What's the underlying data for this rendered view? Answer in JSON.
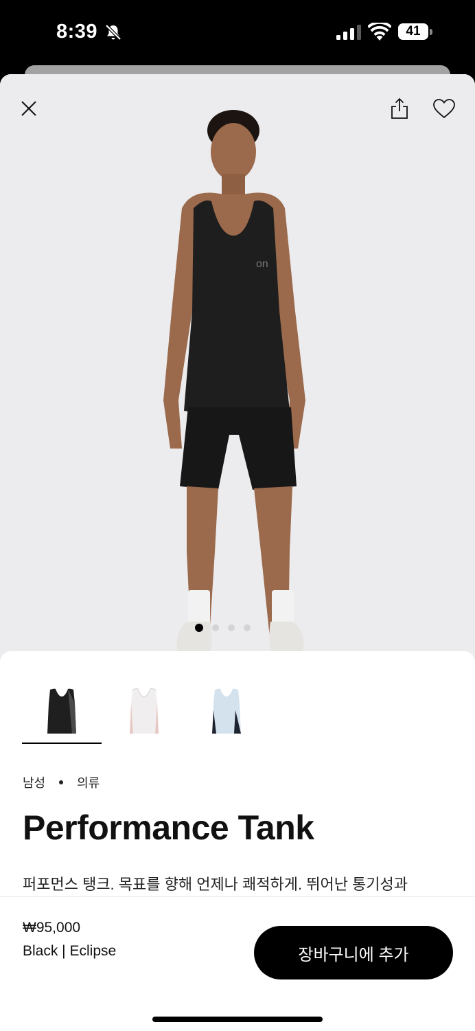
{
  "status_bar": {
    "time": "8:39",
    "battery": "41"
  },
  "colors": {
    "accent": "#000000",
    "hero_bg": "#ececee",
    "text": "#111111"
  },
  "icons": {
    "close": "close-icon",
    "share": "share-icon",
    "favorite": "heart-icon",
    "bell_off": "bell-off-icon",
    "signal": "cellular-signal-icon",
    "wifi": "wifi-icon",
    "battery": "battery-icon"
  },
  "gallery": {
    "image_count": 4,
    "active_index": 0
  },
  "variants": [
    {
      "color": "black",
      "selected": true
    },
    {
      "color": "white",
      "selected": false
    },
    {
      "color": "light-blue",
      "selected": false
    }
  ],
  "product": {
    "category_gender": "남성",
    "category_type": "의류",
    "title": "Performance Tank",
    "description": "퍼포먼스 탱크. 목표를 향해 언제나 쾌적하게. 뛰어난 통기성과"
  },
  "purchase": {
    "price": "₩95,000",
    "color_label": "Black | Eclipse",
    "add_to_cart_label": "장바구니에 추가"
  }
}
